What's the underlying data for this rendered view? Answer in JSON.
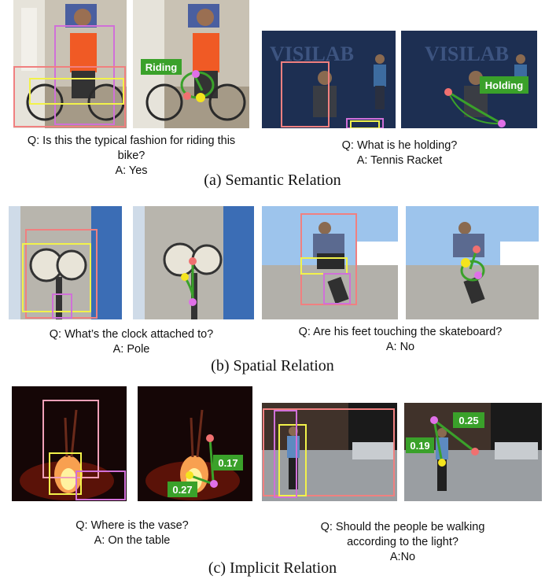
{
  "colors": {
    "box_pink": "#f08080",
    "box_violet": "#d070d8",
    "box_yellow": "#f2f24a",
    "relation_green": "#3aa12a",
    "dot_red": "#f07070",
    "dot_yellow": "#f4e41e",
    "dot_magenta": "#e070e8"
  },
  "semantic": {
    "caption": "(a) Semantic Relation",
    "bike": {
      "relation_label": "Riding",
      "question": "Q: Is this the typical fashion for riding this bike?",
      "answer": "A: Yes"
    },
    "tennis": {
      "scene_text": "VISILAB",
      "relation_label": "Holding",
      "question": "Q: What is he holding?",
      "answer": "A: Tennis Racket"
    }
  },
  "spatial": {
    "caption": "(b) Spatial Relation",
    "clock": {
      "question": "Q: What’s the clock attached to?",
      "answer": "A: Pole"
    },
    "skate": {
      "question": "Q: Are his feet touching the skateboard?",
      "answer": "A: No"
    }
  },
  "implicit": {
    "caption": "(c) Implicit Relation",
    "vase": {
      "score_top": "0.17",
      "score_bottom": "0.27",
      "question": "Q: Where is the vase?",
      "answer": "A: On the table"
    },
    "street": {
      "score_left": "0.19",
      "score_right": "0.25",
      "question": "Q: Should the people be walking according to the light?",
      "answer": "A:No"
    }
  }
}
